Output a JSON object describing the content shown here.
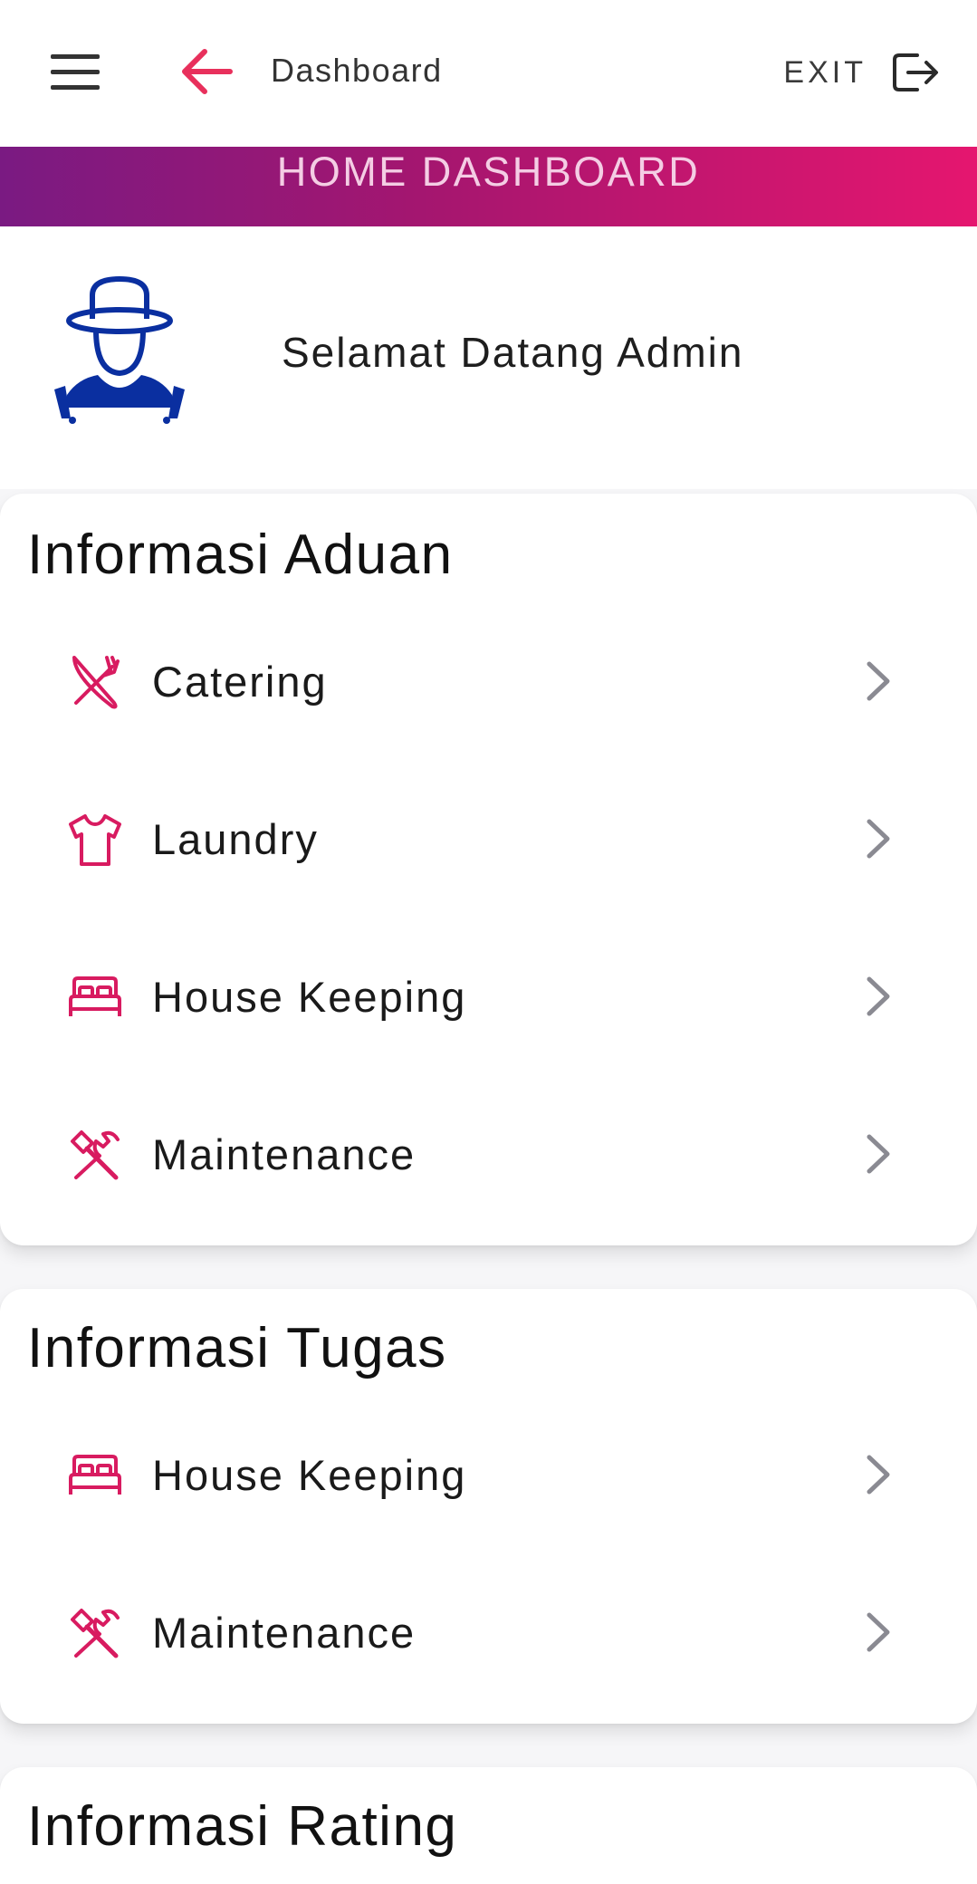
{
  "appbar": {
    "title": "Dashboard",
    "exit_label": "EXIT",
    "back_color": "#e8305c"
  },
  "banner": {
    "title": "HOME DASHBOARD",
    "gradient": [
      "#7a1a82",
      "#e5166f"
    ]
  },
  "welcome": {
    "text": "Selamat Datang Admin",
    "avatar_icon": "worker-avatar-icon",
    "avatar_color": "#0a2fa0"
  },
  "accent_color": "#d81b60",
  "chevron_color": "#8a8a92",
  "sections": {
    "aduan": {
      "title": "Informasi Aduan",
      "items": [
        {
          "label": "Catering",
          "icon": "utensils-icon"
        },
        {
          "label": "Laundry",
          "icon": "shirt-icon"
        },
        {
          "label": "House Keeping",
          "icon": "bed-icon"
        },
        {
          "label": "Maintenance",
          "icon": "tools-icon"
        }
      ]
    },
    "tugas": {
      "title": "Informasi Tugas",
      "items": [
        {
          "label": "House Keeping",
          "icon": "bed-icon"
        },
        {
          "label": "Maintenance",
          "icon": "tools-icon"
        }
      ]
    },
    "rating": {
      "title": "Informasi Rating"
    }
  }
}
